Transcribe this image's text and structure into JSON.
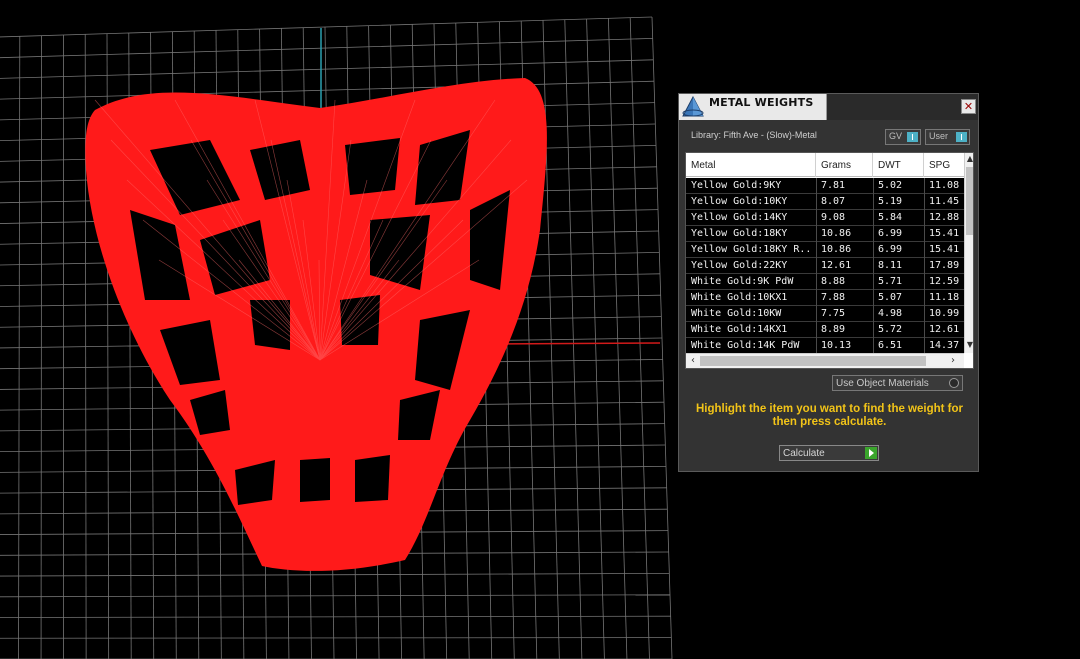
{
  "panel": {
    "title": "METAL WEIGHTS",
    "close_label": "✕",
    "library_label": "Library: Fifth Ave - (Slow)-Metal",
    "toggle_gv_label": "GV",
    "toggle_user_label": "User",
    "columns": {
      "metal": "Metal",
      "grams": "Grams",
      "dwt": "DWT",
      "spg": "SPG"
    },
    "rows": [
      {
        "metal": "Yellow Gold:9KY",
        "grams": "7.81",
        "dwt": "5.02",
        "spg": "11.08"
      },
      {
        "metal": "Yellow Gold:10KY",
        "grams": "8.07",
        "dwt": "5.19",
        "spg": "11.45"
      },
      {
        "metal": "Yellow Gold:14KY",
        "grams": "9.08",
        "dwt": "5.84",
        "spg": "12.88"
      },
      {
        "metal": "Yellow Gold:18KY",
        "grams": "10.86",
        "dwt": "6.99",
        "spg": "15.41"
      },
      {
        "metal": "Yellow Gold:18KY R...",
        "grams": "10.86",
        "dwt": "6.99",
        "spg": "15.41"
      },
      {
        "metal": "Yellow Gold:22KY",
        "grams": "12.61",
        "dwt": "8.11",
        "spg": "17.89"
      },
      {
        "metal": "White Gold:9K PdW",
        "grams": "8.88",
        "dwt": "5.71",
        "spg": "12.59"
      },
      {
        "metal": "White Gold:10KX1",
        "grams": "7.88",
        "dwt": "5.07",
        "spg": "11.18"
      },
      {
        "metal": "White Gold:10KW",
        "grams": "7.75",
        "dwt": "4.98",
        "spg": "10.99"
      },
      {
        "metal": "White Gold:14KX1",
        "grams": "8.89",
        "dwt": "5.72",
        "spg": "12.61"
      },
      {
        "metal": "White Gold:14K PdW",
        "grams": "10.13",
        "dwt": "6.51",
        "spg": "14.37"
      }
    ],
    "use_object_materials_label": "Use Object Materials",
    "instruction": "Highlight the item you want to find the weight for then press calculate.",
    "calculate_label": "Calculate"
  },
  "colors": {
    "model": "#ff1a1a",
    "grid": "#8a8a8a",
    "axis_y": "#2a9fb0",
    "axis_x": "#d21a1a",
    "instruction": "#f2c418",
    "calculate_arrow": "#3aa52c",
    "toggle_switch": "#4db1c6"
  },
  "icons": {
    "logo": "pyramid-logo-icon",
    "close": "close-icon",
    "scroll_up": "scroll-up-icon",
    "scroll_down": "scroll-down-icon",
    "scroll_left": "scroll-left-icon",
    "scroll_right": "scroll-right-icon",
    "calculate": "play-arrow-icon"
  }
}
